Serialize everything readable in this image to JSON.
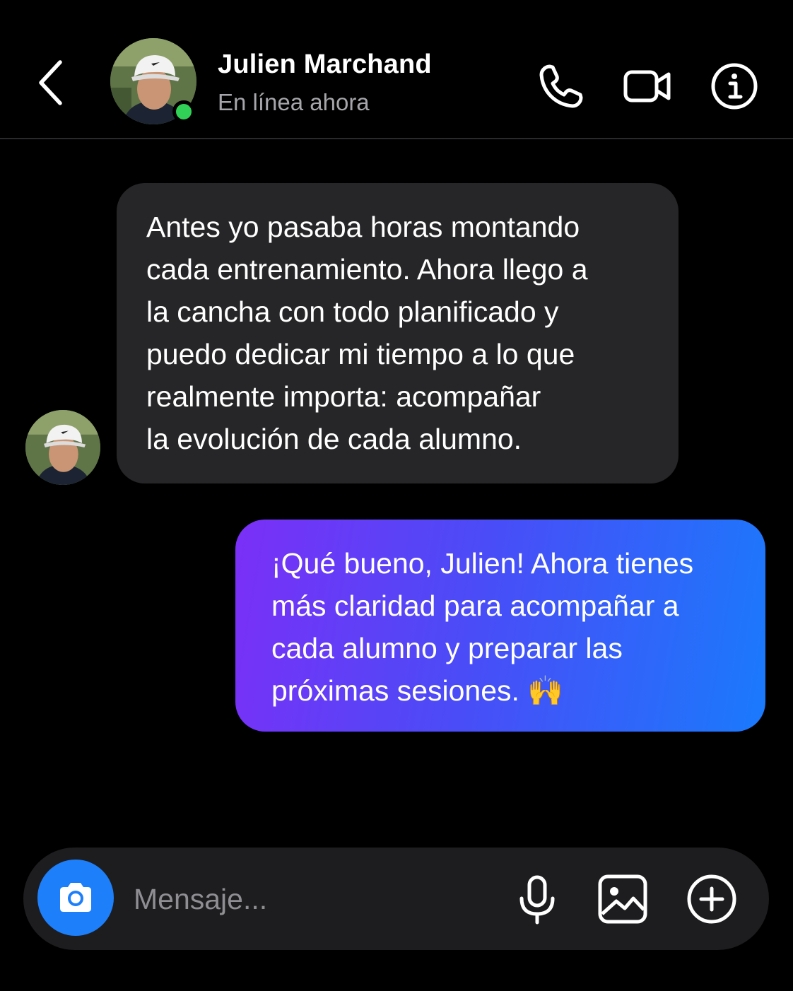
{
  "header": {
    "back_icon": "chevron-left-icon",
    "contact_name": "Julien Marchand",
    "status": "En línea ahora",
    "online_color": "#31d158",
    "actions": [
      "phone-icon",
      "video-camera-icon",
      "info-icon"
    ]
  },
  "messages": [
    {
      "direction": "incoming",
      "lines": [
        "Antes yo pasaba horas montando",
        "cada entrenamiento. Ahora llego a",
        "la cancha con todo planificado y",
        "puedo dedicar mi tiempo a lo que",
        "realmente importa: acompañar",
        "la evolución de cada alumno."
      ]
    },
    {
      "direction": "outgoing",
      "lines": [
        "¡Qué bueno, Julien! Ahora tienes",
        "más claridad para acompañar a",
        "cada alumno y preparar las",
        "próximas sesiones. 🙌"
      ]
    }
  ],
  "composer": {
    "placeholder": "Mensaje...",
    "camera_icon": "camera-icon",
    "icons": [
      "microphone-icon",
      "image-icon",
      "plus-circle-icon"
    ]
  },
  "colors": {
    "background": "#000000",
    "incoming_bubble": "#262628",
    "outgoing_gradient_start": "#7b2ff7",
    "outgoing_gradient_end": "#1a7afc",
    "camera_button": "#1d7ffa",
    "composer_background": "#1d1d1f"
  }
}
